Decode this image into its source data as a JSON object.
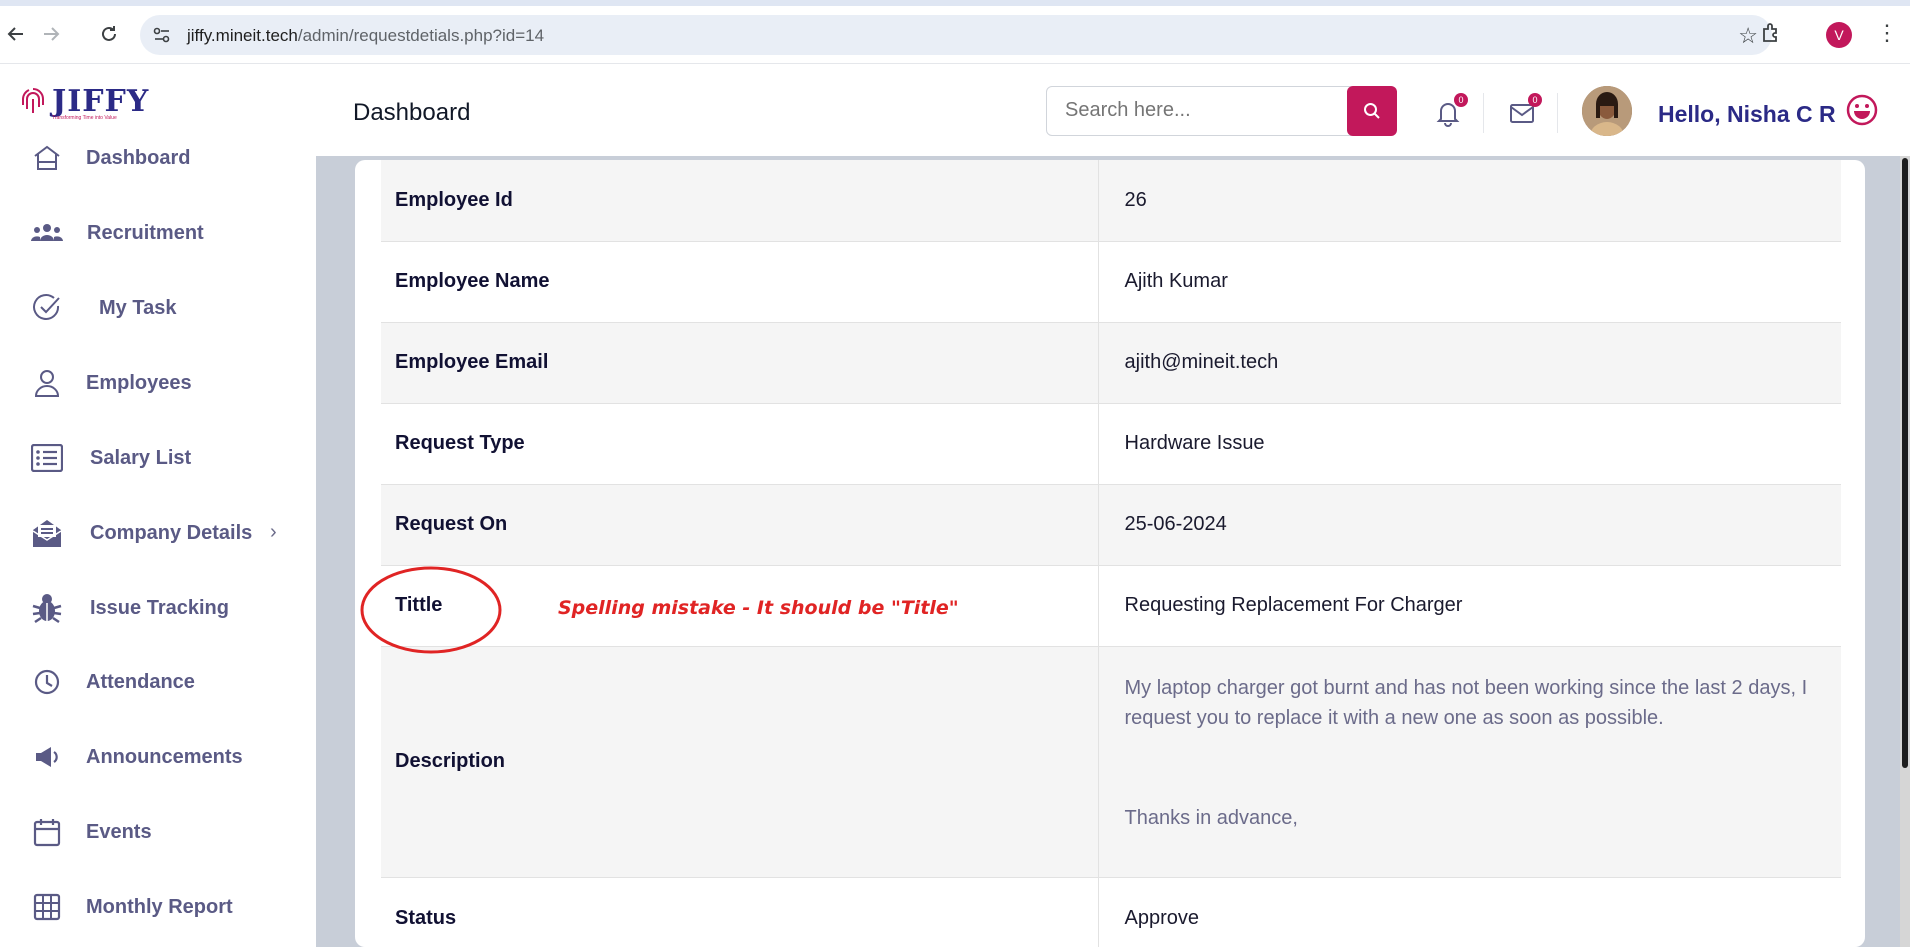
{
  "browser": {
    "url_domain": "jiffy.mineit.tech",
    "url_path": "/admin/requestdetials.php?id=14",
    "profile_initial": "V"
  },
  "logo": {
    "text": "JIFFY",
    "tagline": "Transforming Time into Value"
  },
  "sidebar": {
    "items": [
      {
        "label": "Dashboard",
        "icon": "home-icon"
      },
      {
        "label": "Recruitment",
        "icon": "users-icon"
      },
      {
        "label": "My Task",
        "icon": "check-circle-icon"
      },
      {
        "label": "Employees",
        "icon": "user-icon"
      },
      {
        "label": "Salary List",
        "icon": "list-icon"
      },
      {
        "label": "Company Details",
        "icon": "mail-open-icon"
      },
      {
        "label": "Issue Tracking",
        "icon": "bug-icon"
      },
      {
        "label": "Attendance",
        "icon": "clock-icon"
      },
      {
        "label": "Announcements",
        "icon": "megaphone-icon"
      },
      {
        "label": "Events",
        "icon": "calendar-icon"
      },
      {
        "label": "Monthly Report",
        "icon": "table-icon"
      }
    ]
  },
  "header": {
    "title": "Dashboard",
    "search_placeholder": "Search here...",
    "notifications_count": "0",
    "messages_count": "0",
    "greeting": "Hello, Nisha C R"
  },
  "details": {
    "rows": [
      {
        "key": "Employee Id",
        "value": "26"
      },
      {
        "key": "Employee Name",
        "value": "Ajith Kumar"
      },
      {
        "key": "Employee Email",
        "value": "ajith@mineit.tech"
      },
      {
        "key": "Request Type",
        "value": "Hardware Issue"
      },
      {
        "key": "Request On",
        "value": "25-06-2024"
      },
      {
        "key": "Tittle",
        "value": "Requesting Replacement For Charger"
      },
      {
        "key": "Description",
        "value_line1": "My laptop charger got burnt and has not been working since the last 2 days, I request you to replace it with a new one as soon as possible.",
        "value_line2": "Thanks in advance,"
      },
      {
        "key": "Status",
        "value": "Approve"
      }
    ]
  },
  "annotation": {
    "text": "Spelling mistake - It should be \"Title\"",
    "color": "#e02424"
  },
  "colors": {
    "brand": "#2b2a86",
    "accent": "#c2185b",
    "sidebar_text": "#5a5a85"
  }
}
